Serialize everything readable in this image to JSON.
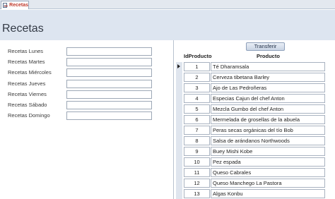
{
  "tab": {
    "label": "Recetas",
    "icon": "form-icon"
  },
  "form": {
    "title": "Recetas"
  },
  "days": [
    {
      "label": "Recetas Lunes",
      "value": ""
    },
    {
      "label": "Recetas Martes",
      "value": ""
    },
    {
      "label": "Recetas Miércoles",
      "value": ""
    },
    {
      "label": "Recetas Jueves",
      "value": ""
    },
    {
      "label": "Recetas Viernes",
      "value": ""
    },
    {
      "label": "Recetas Sábado",
      "value": ""
    },
    {
      "label": "Recetas Domingo",
      "value": ""
    }
  ],
  "subform": {
    "button_label": "Transferir",
    "columns": {
      "id": "IdProducto",
      "product": "Producto"
    },
    "rows": [
      {
        "id": "1",
        "product": "Té Dharamsala"
      },
      {
        "id": "2",
        "product": "Cerveza tibetana Barley"
      },
      {
        "id": "3",
        "product": "Ajo de Las Pedroñeras"
      },
      {
        "id": "4",
        "product": "Especias Cajun del chef Anton"
      },
      {
        "id": "5",
        "product": "Mezcla Gumbo del chef Anton"
      },
      {
        "id": "6",
        "product": "Mermelada de grosellas de la abuela"
      },
      {
        "id": "7",
        "product": "Peras secas orgánicas del tío Bob"
      },
      {
        "id": "8",
        "product": "Salsa de arándanos Northwoods"
      },
      {
        "id": "9",
        "product": "Buey Mishi Kobe"
      },
      {
        "id": "10",
        "product": "Pez espada"
      },
      {
        "id": "11",
        "product": "Queso Cabrales"
      },
      {
        "id": "12",
        "product": "Queso Manchego La Pastora"
      },
      {
        "id": "13",
        "product": "Algas Konbu"
      }
    ]
  },
  "colors": {
    "header_bg": "#dde5f0",
    "tab_text": "#c0392b"
  }
}
